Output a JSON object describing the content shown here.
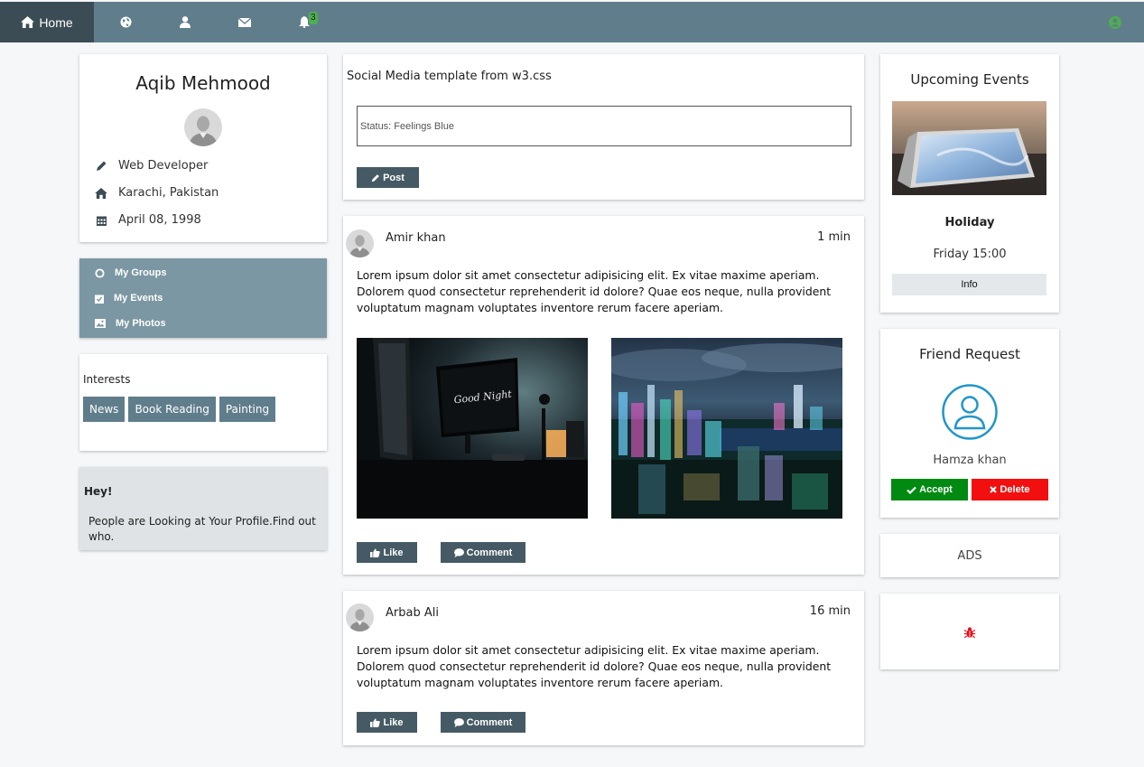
{
  "nav": {
    "home_label": "Home",
    "notification_count": "3",
    "items": [
      "globe-icon",
      "user-icon",
      "envelope-icon",
      "bell-icon"
    ],
    "status_color": "#4caf50"
  },
  "profile": {
    "name": "Aqib Mehmood",
    "job": "Web Developer",
    "location": "Karachi, Pakistan",
    "birthday": "April 08, 1998"
  },
  "menu": {
    "groups": "My Groups",
    "events": "My Events",
    "photos": "My Photos"
  },
  "interests": {
    "title": "Interests",
    "tags": [
      "News",
      "Book Reading",
      "Painting"
    ]
  },
  "alert": {
    "title": "Hey!",
    "text": "People are Looking at Your Profile.Find out who."
  },
  "composer": {
    "title": "Social Media template from w3.css",
    "status_value": "Status: Feelings Blue",
    "post_label": "Post"
  },
  "posts": [
    {
      "author": "Amir khan",
      "time": "1 min",
      "body": "Lorem ipsum dolor sit amet consectetur adipisicing elit. Ex vitae maxime aperiam. Dolorem quod consectetur reprehenderit id dolore? Quae eos neque, nulla provident voluptatum magnam voluptates inventore rerum facere aperiam.",
      "like_label": "Like",
      "comment_label": "Comment"
    },
    {
      "author": "Arbab Ali",
      "time": "16 min",
      "body": "Lorem ipsum dolor sit amet consectetur adipisicing elit. Ex vitae maxime aperiam. Dolorem quod consectetur reprehenderit id dolore? Quae eos neque, nulla provident voluptatum magnam voluptates inventore rerum facere aperiam.",
      "like_label": "Like",
      "comment_label": "Comment"
    }
  ],
  "events": {
    "title": "Upcoming Events",
    "name": "Holiday",
    "time": "Friday 15:00",
    "info_label": "Info"
  },
  "friend_request": {
    "title": "Friend Request",
    "name": "Hamza khan",
    "accept_label": "Accept",
    "delete_label": "Delete"
  },
  "ads": {
    "label": "ADS"
  },
  "colors": {
    "nav": "#607d8b",
    "nav_active": "#3b4c55",
    "accent": "#455a64",
    "accept": "#008a12",
    "delete": "#f20f0f",
    "bug": "#e0101a"
  }
}
